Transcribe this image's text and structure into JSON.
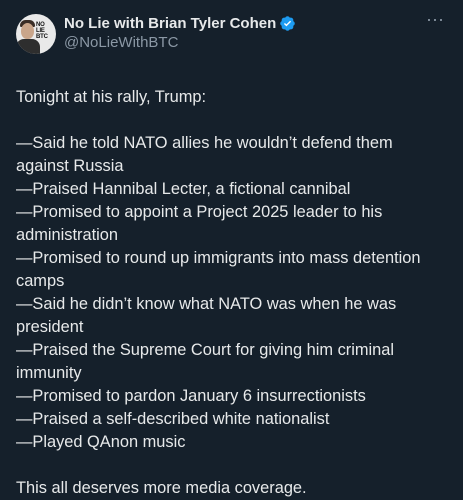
{
  "tweet": {
    "author": {
      "display_name": "No Lie with Brian Tyler Cohen",
      "handle": "@NoLieWithBTC",
      "verified": true,
      "avatar_logo": [
        "NO",
        "LIE",
        "BTC"
      ]
    },
    "more_label": "···",
    "intro": "Tonight at his rally, Trump:",
    "lines": [
      "—Said he told NATO allies he wouldn’t defend them against Russia",
      "—Praised Hannibal Lecter, a fictional cannibal",
      "—Promised to appoint a Project 2025 leader to his administration",
      "—Promised to round up immigrants into mass detention camps",
      "—Said he didn’t know what NATO was when he was president",
      "—Praised the Supreme Court for giving him criminal immunity",
      "—Promised to pardon January 6 insurrectionists",
      "—Praised a self-described white nationalist",
      "—Played QAnon music"
    ],
    "closing": "This all deserves more media coverage."
  },
  "colors": {
    "background": "#15202b",
    "text": "#e7e9ea",
    "secondary_text": "#8b98a5",
    "verified_badge": "#1d9bf0"
  }
}
